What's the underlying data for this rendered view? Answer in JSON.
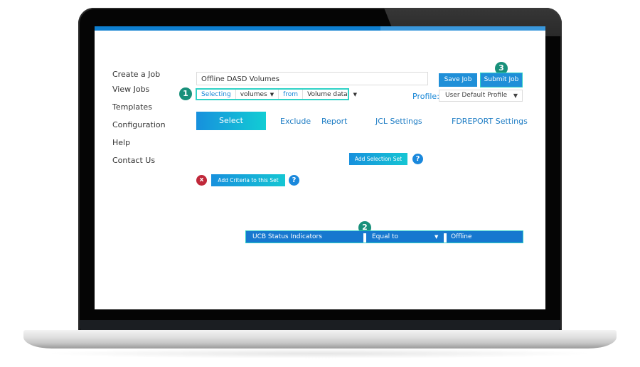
{
  "sidebar": {
    "items": [
      {
        "label": "Create a Job"
      },
      {
        "label": "View Jobs"
      },
      {
        "label": "Templates"
      },
      {
        "label": "Configuration"
      },
      {
        "label": "Help"
      },
      {
        "label": "Contact Us"
      }
    ]
  },
  "job": {
    "name_value": "Offline DASD Volumes"
  },
  "selector": {
    "selecting_label": "Selecting",
    "object_value": "volumes",
    "from_label": "from",
    "source_value": "Volume data",
    "arrow": "▼"
  },
  "toolbar": {
    "save_label": "Save Job",
    "submit_label": "Submit Job"
  },
  "profile": {
    "label": "Profile:",
    "selected": "User Default Profile",
    "arrow": "▼"
  },
  "tabs": [
    {
      "label": "Select",
      "active": true
    },
    {
      "label": "Exclude"
    },
    {
      "label": "Report"
    },
    {
      "label": "JCL Settings"
    },
    {
      "label": "FDREPORT Settings"
    }
  ],
  "actions": {
    "add_selection_set": "Add Selection Set",
    "add_criteria": "Add Criteria to this Set",
    "help_glyph": "?",
    "remove_glyph": "x"
  },
  "criteria_row": {
    "field": "UCB Status Indicators",
    "operator": "Equal to",
    "operator_arrow": "▼",
    "value": "Offline"
  },
  "callouts": [
    "1",
    "2",
    "3"
  ],
  "colors": {
    "accent": "#1f8fd8",
    "highlight": "#2fd2c6",
    "callout": "#18907a",
    "danger": "#c0283a"
  }
}
